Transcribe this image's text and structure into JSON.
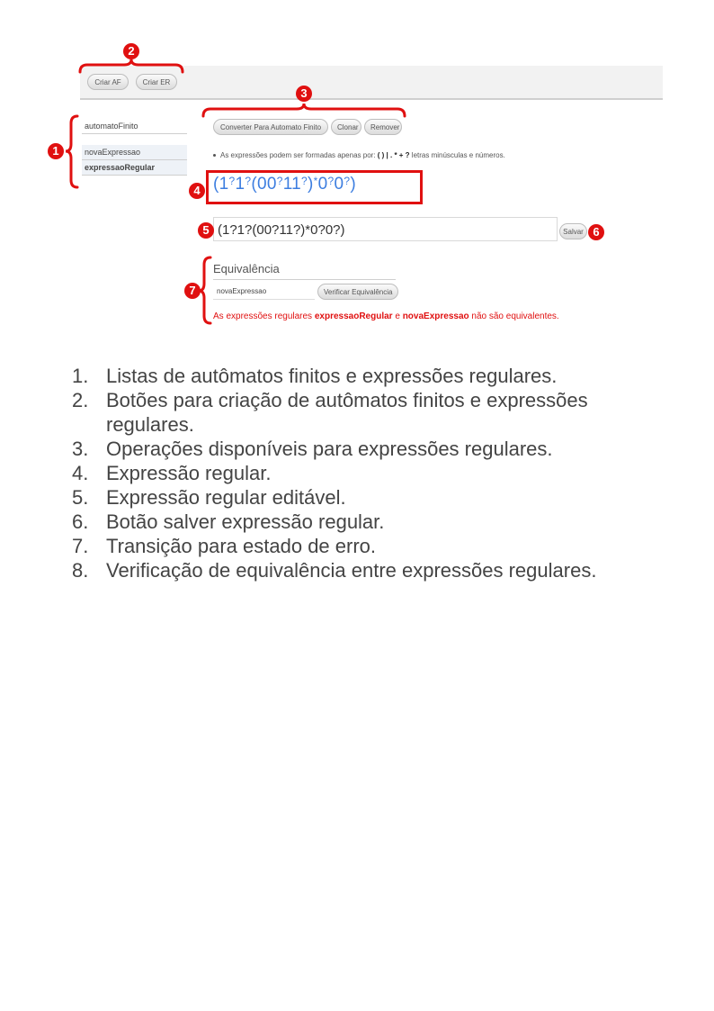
{
  "toolbar": {
    "criar_af": "Criar AF",
    "criar_er": "Criar ER"
  },
  "sidebar": {
    "automata": [
      "automatoFinito"
    ],
    "expressions": [
      {
        "label": "novaExpressao",
        "selected": false
      },
      {
        "label": "expressaoRegular",
        "selected": true
      }
    ]
  },
  "operations": {
    "convert": "Converter Para Automato Finito",
    "clone": "Clonar",
    "remove": "Remover"
  },
  "note": {
    "prefix": "As expressões podem ser formadas apenas por: ",
    "symbols": "( ) | . * + ?",
    "suffix": " letras minúsculas e números."
  },
  "regex_display": [
    "(1",
    "?",
    "1",
    "?",
    "(00",
    "?",
    "11",
    "?",
    ")",
    "*",
    "0",
    "?",
    "0",
    "?",
    ")"
  ],
  "editor": {
    "value": "(1?1?(00?11?)*0?0?)",
    "save_label": "Salvar"
  },
  "equivalence": {
    "title": "Equivalência",
    "input_value": "novaExpressao",
    "verify_label": "Verificar Equivalência",
    "result_prefix": "As expressões regulares ",
    "result_a": "expressaoRegular",
    "result_mid": " e ",
    "result_b": "novaExpressao",
    "result_suffix": " não são equivalentes."
  },
  "badges": [
    "1",
    "2",
    "3",
    "4",
    "5",
    "6",
    "7"
  ],
  "legend": [
    {
      "num": "1.",
      "text": "Listas de autômatos finitos e expressões regulares."
    },
    {
      "num": "2.",
      "text": "Botões para criação de autômatos finitos e expressões regulares."
    },
    {
      "num": "3.",
      "text": "Operações disponíveis para expressões regulares."
    },
    {
      "num": "4.",
      "text": "Expressão regular."
    },
    {
      "num": "5.",
      "text": "Expressão regular editável."
    },
    {
      "num": "6.",
      "text": "Botão salver expressão regular."
    },
    {
      "num": "7.",
      "text": "Transição para estado de erro."
    },
    {
      "num": "8.",
      "text": "Verificação de equivalência entre expressões regulares."
    }
  ],
  "colors": {
    "annotation": "#e01010",
    "regex": "#3d7ee0"
  }
}
